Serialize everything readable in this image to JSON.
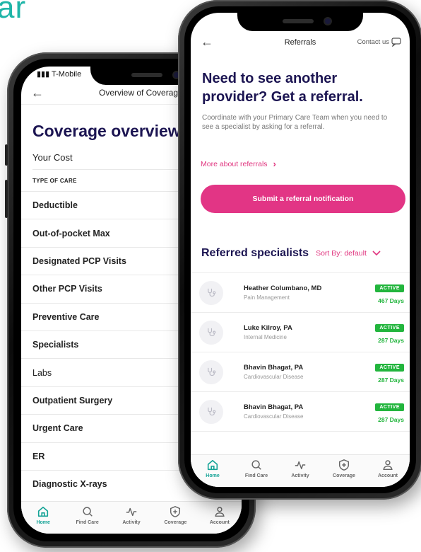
{
  "background_text": "ar",
  "colors": {
    "accent_pink": "#e23585",
    "teal": "#14a396",
    "navy": "#1c1552",
    "status_green": "#22b53d"
  },
  "back_phone": {
    "status": {
      "carrier": "T-Mobile"
    },
    "header": {
      "title": "Overview of Coverage"
    },
    "heading": "Coverage overview",
    "your_cost": "Your Cost",
    "type_of_care": "TYPE OF CARE",
    "items": [
      {
        "label": "Deductible"
      },
      {
        "label": "Out-of-pocket Max"
      },
      {
        "label": "Designated PCP Visits"
      },
      {
        "label": "Other PCP Visits"
      },
      {
        "label": "Preventive Care"
      },
      {
        "label": "Specialists"
      },
      {
        "label": "Labs"
      },
      {
        "label": "Outpatient Surgery"
      },
      {
        "label": "Urgent Care"
      },
      {
        "label": "ER"
      },
      {
        "label": "Diagnostic X-rays"
      }
    ]
  },
  "front_phone": {
    "header": {
      "title": "Referrals",
      "contact": "Contact us"
    },
    "hero_title": "Need to see another provider? Get a referral.",
    "hero_sub": "Coordinate with your Primary Care Team when you need to see a specialist by asking for a referral.",
    "more_link": "More about referrals",
    "submit_button": "Submit a referral notification",
    "section_title": "Referred specialists",
    "sort_label": "Sort By: default",
    "referrals": [
      {
        "name": "Heather Columbano, MD",
        "specialty": "Pain Management",
        "status": "ACTIVE",
        "days": "467 Days"
      },
      {
        "name": "Luke Kilroy, PA",
        "specialty": "Internal Medicine",
        "status": "ACTIVE",
        "days": "287 Days"
      },
      {
        "name": "Bhavin Bhagat, PA",
        "specialty": "Cardiovascular Disease",
        "status": "ACTIVE",
        "days": "287 Days"
      },
      {
        "name": "Bhavin Bhagat, PA",
        "specialty": "Cardiovascular Disease",
        "status": "ACTIVE",
        "days": "287 Days"
      }
    ]
  },
  "tabbar": {
    "active": "Home",
    "tabs": [
      {
        "label": "Home",
        "icon": "home-icon"
      },
      {
        "label": "Find Care",
        "icon": "search-icon"
      },
      {
        "label": "Activity",
        "icon": "activity-icon"
      },
      {
        "label": "Coverage",
        "icon": "shield-icon"
      },
      {
        "label": "Account",
        "icon": "person-icon"
      }
    ]
  }
}
